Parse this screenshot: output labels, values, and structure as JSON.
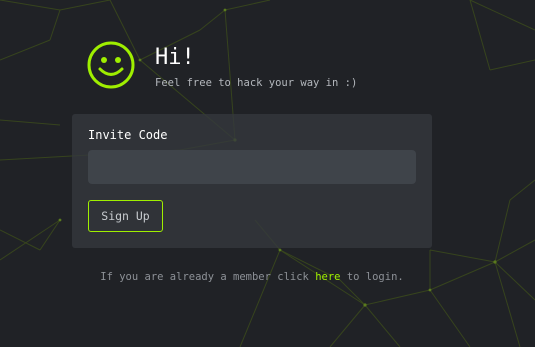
{
  "colors": {
    "background": "#202226",
    "card": "#34383d",
    "accent": "#9fef00",
    "input": "#3f444a"
  },
  "header": {
    "icon": "smiley-icon",
    "title": "Hi!",
    "subtitle": "Feel free to hack your way in :)"
  },
  "form": {
    "label": "Invite Code",
    "input_value": "",
    "button_label": "Sign Up"
  },
  "footer": {
    "text_before": "If you are already a member click ",
    "link_text": "here",
    "text_after": " to login."
  }
}
